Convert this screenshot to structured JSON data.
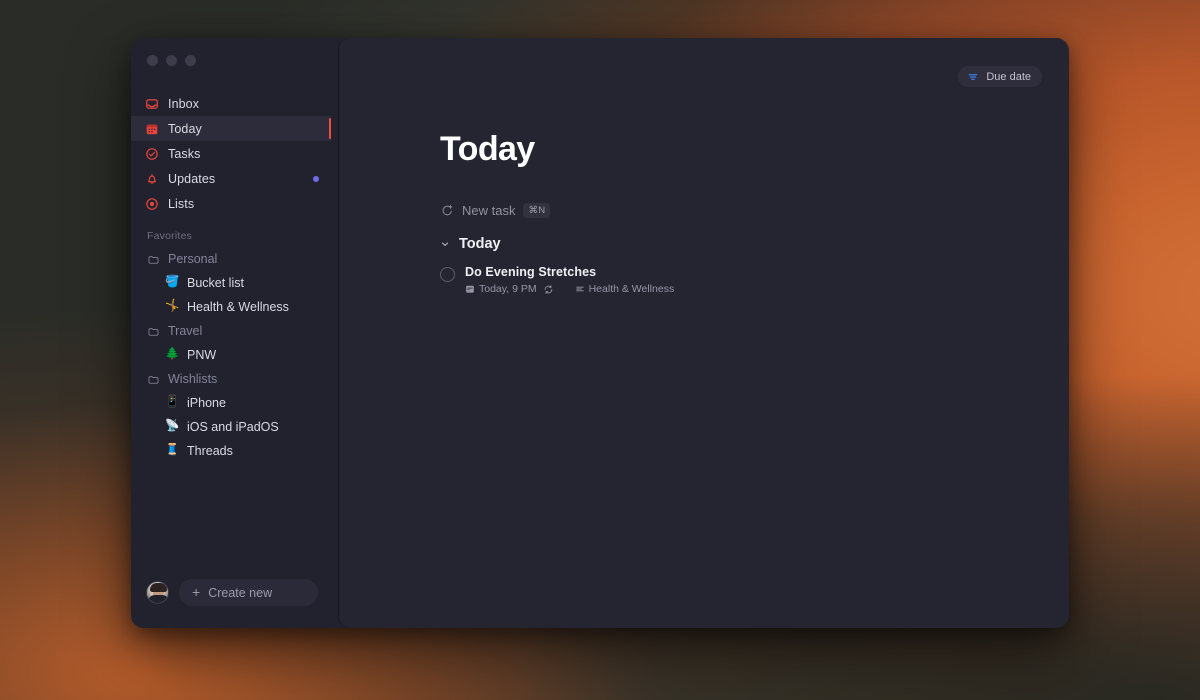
{
  "desktop": {
    "background_colors": {
      "orange": "#c9642f",
      "dark_olive": "#2d2e27",
      "deep": "#20231f"
    }
  },
  "window": {
    "traffic_lights": [
      "close",
      "minimize",
      "zoom"
    ],
    "chrome_color": "#22222f"
  },
  "sidebar": {
    "nav": [
      {
        "label": "Inbox",
        "icon": "inbox-icon",
        "selected": false,
        "badge": false
      },
      {
        "label": "Today",
        "icon": "calendar-icon",
        "selected": true,
        "badge": false
      },
      {
        "label": "Tasks",
        "icon": "check-circle-icon",
        "selected": false,
        "badge": false
      },
      {
        "label": "Updates",
        "icon": "bell-icon",
        "selected": false,
        "badge": true
      },
      {
        "label": "Lists",
        "icon": "target-circle-icon",
        "selected": false,
        "badge": false
      }
    ],
    "section_label": "Favorites",
    "groups": [
      {
        "label": "Personal",
        "icon": "folder-icon",
        "children": [
          {
            "label": "Bucket list",
            "emoji": "🪣"
          },
          {
            "label": "Health & Wellness",
            "emoji": "🤸"
          }
        ]
      },
      {
        "label": "Travel",
        "icon": "folder-icon",
        "children": [
          {
            "label": "PNW",
            "emoji": "🌲"
          }
        ]
      },
      {
        "label": "Wishlists",
        "icon": "folder-icon",
        "children": [
          {
            "label": "iPhone",
            "emoji": "📱"
          },
          {
            "label": "iOS and iPadOS",
            "emoji": "📡"
          },
          {
            "label": "Threads",
            "emoji": "🧵"
          }
        ]
      }
    ],
    "footer": {
      "avatar_name": "user-avatar",
      "create_new_label": "Create new",
      "create_new_plus": "+"
    },
    "accent_color": "#ef4d43",
    "badge_color": "#6f6ce8"
  },
  "main": {
    "due_date_button": {
      "label": "Due date",
      "icon": "sort-filter-icon",
      "icon_color": "#3f7ee8"
    },
    "title": "Today",
    "new_task": {
      "label": "New task",
      "shortcut": "⌘N",
      "icon": "circle-plus-icon"
    },
    "group": {
      "label": "Today",
      "chevron": "chevron-down-icon",
      "expanded": true
    },
    "tasks": [
      {
        "title": "Do Evening Stretches",
        "checked": false,
        "due": "Today, 9 PM",
        "due_icon": "calendar-icon",
        "repeat_icon": "repeat-icon",
        "list": "Health & Wellness",
        "list_icon": "list-lines-icon"
      }
    ]
  }
}
